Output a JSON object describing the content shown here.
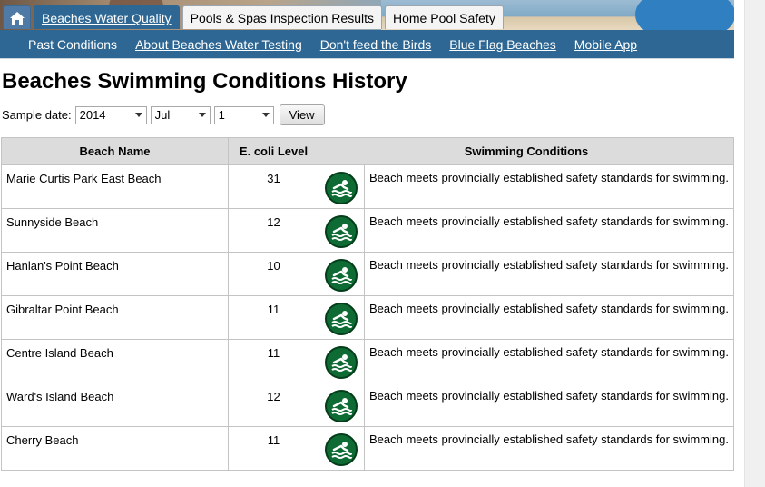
{
  "tabs": {
    "home_icon": "home-icon",
    "items": [
      {
        "label": "Beaches Water Quality"
      },
      {
        "label": "Pools & Spas Inspection Results"
      },
      {
        "label": "Home Pool Safety"
      }
    ]
  },
  "subnav": [
    {
      "label": "Past Conditions"
    },
    {
      "label": "About Beaches Water Testing"
    },
    {
      "label": "Don't feed the Birds"
    },
    {
      "label": "Blue Flag Beaches"
    },
    {
      "label": "Mobile App"
    }
  ],
  "page_title": "Beaches Swimming Conditions History",
  "date_filter": {
    "label": "Sample date:",
    "year": "2014",
    "month": "Jul",
    "day": "1",
    "view_label": "View"
  },
  "table": {
    "headers": [
      "Beach Name",
      "E. coli Level",
      "Swimming Conditions"
    ],
    "rows": [
      {
        "name": "Marie Curtis Park East Beach",
        "level": "31",
        "icon": "swimmer-icon",
        "status": "Beach meets provincially established safety standards for swimming."
      },
      {
        "name": "Sunnyside Beach",
        "level": "12",
        "icon": "swimmer-icon",
        "status": "Beach meets provincially established safety standards for swimming."
      },
      {
        "name": "Hanlan's Point Beach",
        "level": "10",
        "icon": "swimmer-icon",
        "status": "Beach meets provincially established safety standards for swimming."
      },
      {
        "name": "Gibraltar Point Beach",
        "level": "11",
        "icon": "swimmer-icon",
        "status": "Beach meets provincially established safety standards for swimming."
      },
      {
        "name": "Centre Island Beach",
        "level": "11",
        "icon": "swimmer-icon",
        "status": "Beach meets provincially established safety standards for swimming."
      },
      {
        "name": "Ward's Island Beach",
        "level": "12",
        "icon": "swimmer-icon",
        "status": "Beach meets provincially established safety standards for swimming."
      },
      {
        "name": "Cherry Beach",
        "level": "11",
        "icon": "swimmer-icon",
        "status": "Beach meets provincially established safety standards for swimming."
      }
    ]
  },
  "colors": {
    "nav": "#2e6793",
    "safe_icon": "#0e6b33"
  }
}
